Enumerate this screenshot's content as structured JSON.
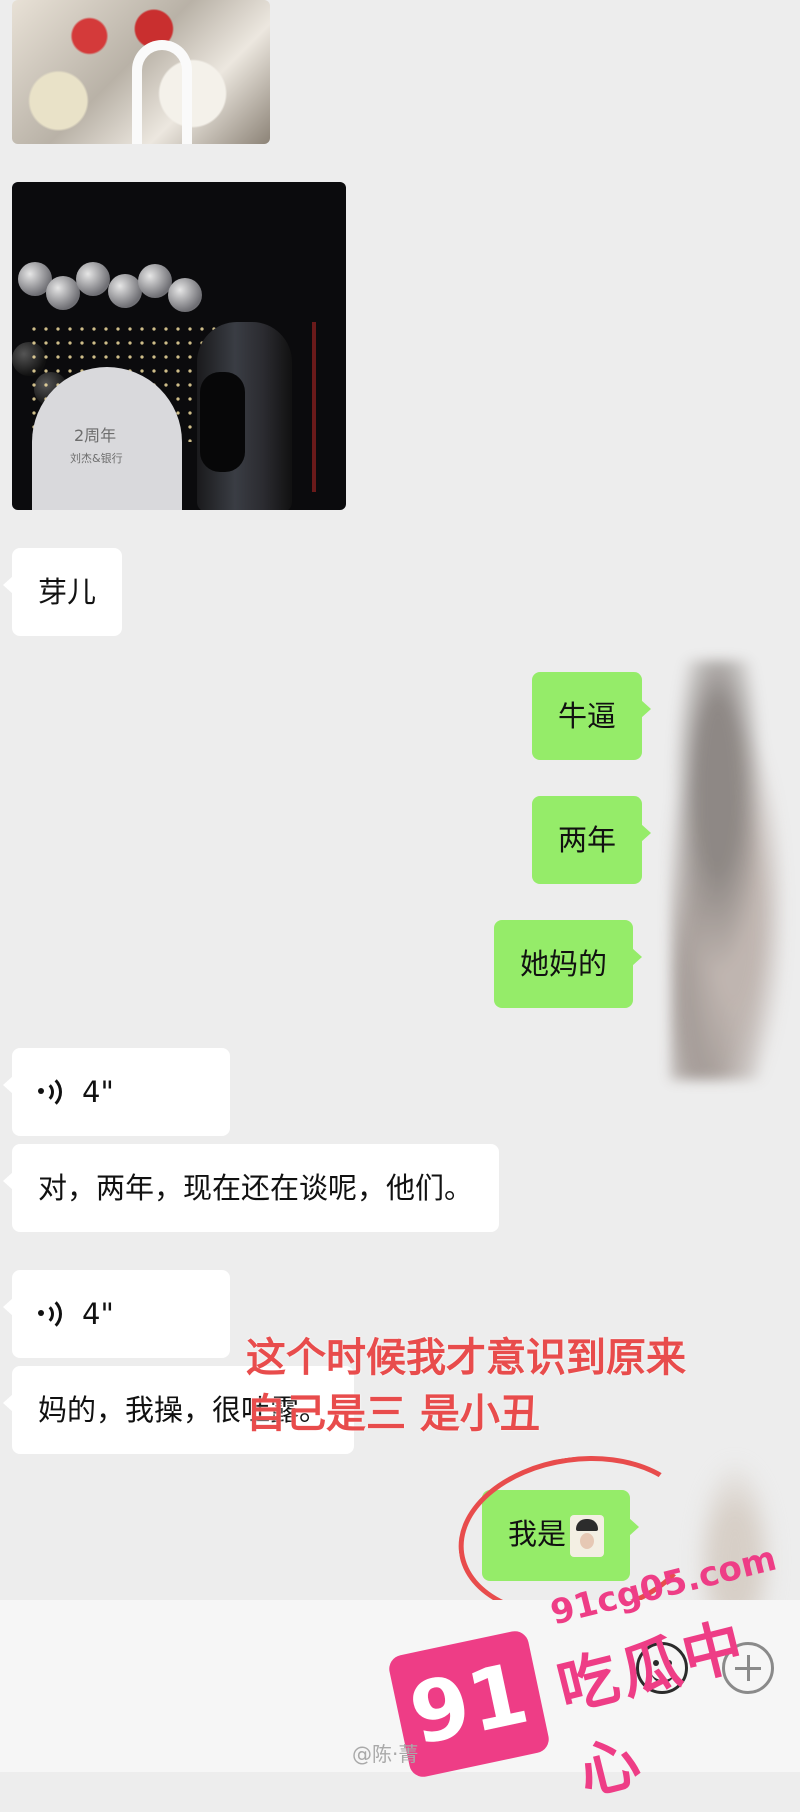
{
  "messages": {
    "m1": "芽儿",
    "m2": "牛逼",
    "m3": "两年",
    "m4": "她妈的",
    "voice1": "4\"",
    "m5": "对，两年，现在还在谈呢，他们。",
    "voice2": "4\"",
    "m6": "妈的，我操，很吐露。",
    "m7": "我是"
  },
  "photos": {
    "party_text_1": "2周年",
    "party_text_2": "刘杰&银行"
  },
  "annotation": {
    "line1": "这个时候我才意识到原来",
    "line2": "自己是三 是小丑",
    "color": "#e84c4c"
  },
  "watermark": {
    "number": "91",
    "url": "91cg05.com",
    "name": "吃瓜中心",
    "color": "#ee3d86"
  },
  "footer": {
    "source": "@陈·菁"
  },
  "colors": {
    "self_bubble": "#95ec69",
    "other_bubble": "#ffffff",
    "background": "#ededed"
  },
  "icons": {
    "voice": "voice-wave-icon",
    "emoji": "emoji-smile-icon",
    "add": "plus-icon"
  }
}
